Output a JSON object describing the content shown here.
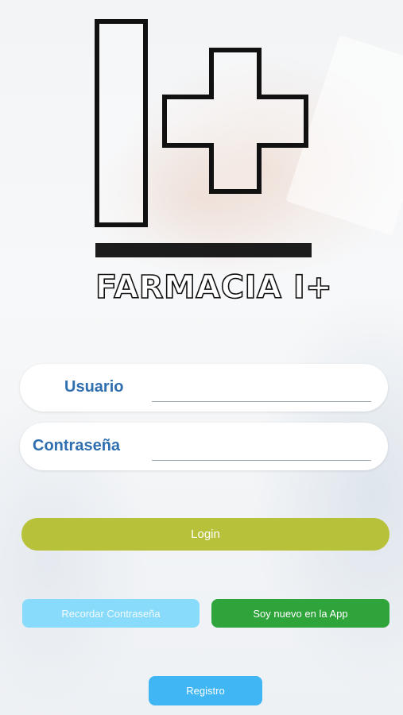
{
  "brand": {
    "name": "FARMACIA I+"
  },
  "login_form": {
    "username_label": "Usuario",
    "username_value": "",
    "password_label": "Contraseña",
    "password_value": ""
  },
  "actions": {
    "login_label": "Login",
    "remember_password_label": "Recordar Contraseña",
    "new_user_label": "Soy nuevo en la App",
    "register_label": "Registro"
  },
  "colors": {
    "label_blue": "#2f6fb0",
    "login_olive": "#b8c13a",
    "remember_light_blue": "#88dbfa",
    "new_user_green": "#2ea43a",
    "register_blue": "#40b6f5"
  }
}
